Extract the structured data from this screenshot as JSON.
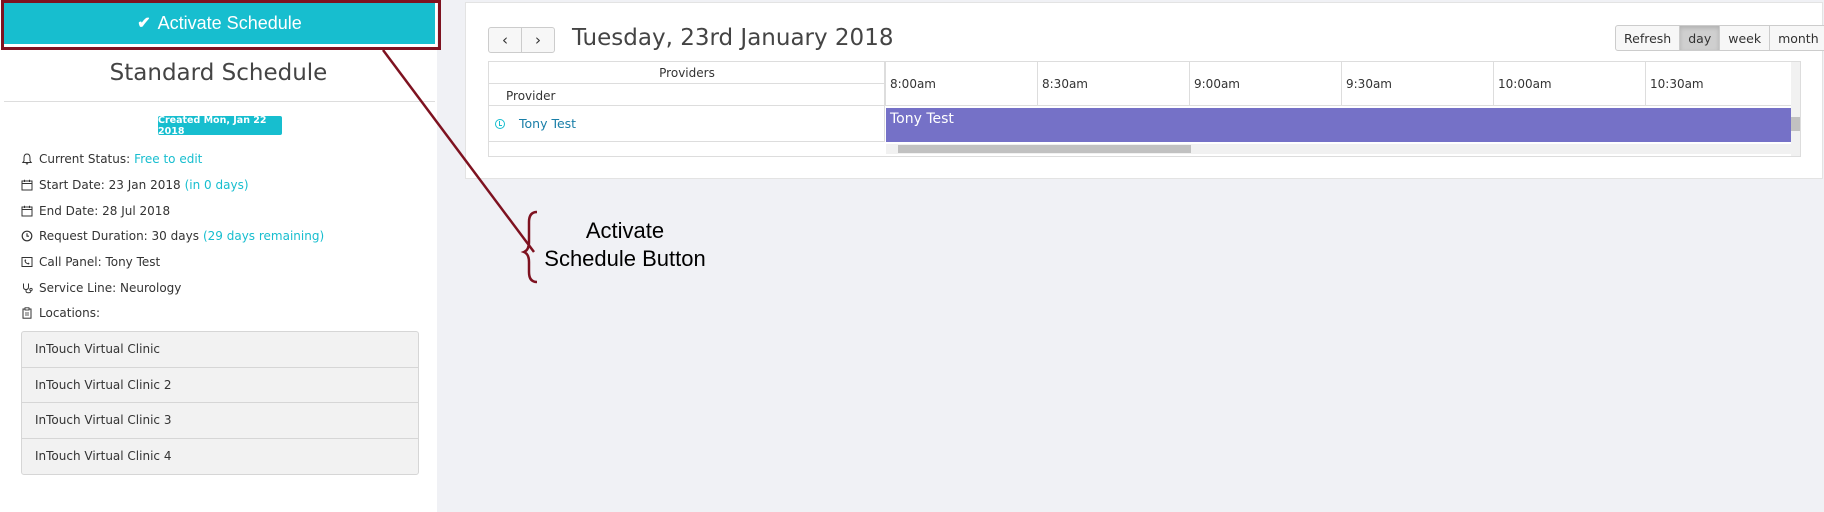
{
  "left": {
    "activate_label": "Activate Schedule",
    "title": "Standard Schedule",
    "created_badge": "Created Mon, Jan 22 2018",
    "status_label": "Current Status:",
    "status_value": "Free to edit",
    "start_label": "Start Date: 23 Jan 2018",
    "start_note": "(in 0 days)",
    "end_label": "End Date: 28 Jul 2018",
    "duration_label": "Request Duration: 30 days",
    "duration_note": "(29 days remaining)",
    "call_panel_label": "Call Panel: Tony Test",
    "service_line_label": "Service Line: Neurology",
    "locations_label": "Locations:",
    "locations": [
      "InTouch Virtual Clinic",
      "InTouch Virtual Clinic 2",
      "InTouch Virtual Clinic 3",
      "InTouch Virtual Clinic 4"
    ]
  },
  "calendar": {
    "prev_icon": "‹",
    "next_icon": "›",
    "date_title": "Tuesday, 23rd January 2018",
    "views": [
      "Refresh",
      "day",
      "week",
      "month"
    ],
    "active_view": "day",
    "providers_header": "Providers",
    "provider_sub_header": "Provider",
    "provider_name": "Tony Test",
    "times": [
      "8:00am",
      "8:30am",
      "9:00am",
      "9:30am",
      "10:00am",
      "10:30am"
    ],
    "event_label": "Tony Test"
  },
  "annotation": {
    "line1": "Activate",
    "line2": "Schedule Button"
  },
  "colors": {
    "accent": "#17becf",
    "event": "#7571c7",
    "highlight": "#7e1220"
  }
}
